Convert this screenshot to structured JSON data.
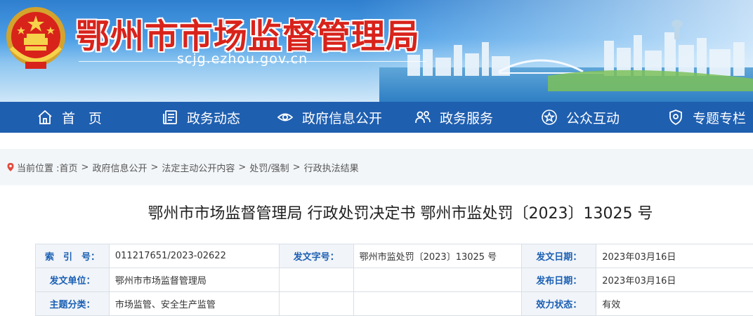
{
  "header": {
    "site_title": "鄂州市市场监督管理局",
    "domain": "scjg.ezhou.gov.cn",
    "emblem_icon": "national-emblem-icon",
    "title_color": "#d8231b"
  },
  "nav": {
    "background": "#1f5fb0",
    "items": [
      {
        "label": "首　页",
        "icon": "home-icon"
      },
      {
        "label": "政务动态",
        "icon": "news-icon"
      },
      {
        "label": "政府信息公开",
        "icon": "eye-icon"
      },
      {
        "label": "政务服务",
        "icon": "people-icon"
      },
      {
        "label": "公众互动",
        "icon": "star-icon"
      },
      {
        "label": "专题专栏",
        "icon": "shield-icon"
      }
    ]
  },
  "breadcrumb": {
    "prefix": "当前位置 :",
    "items": [
      "首页",
      "政府信息公开",
      "法定主动公开内容",
      "处罚/强制",
      "行政执法结果"
    ],
    "separator": ">"
  },
  "document": {
    "title": "鄂州市市场监督管理局 行政处罚决定书 鄂州市监处罚〔2023〕13025 号"
  },
  "info_table": {
    "rows": [
      [
        {
          "label": "索　引　号：",
          "value": "011217651/2023-02622"
        },
        {
          "label": "发文字号：",
          "value": "鄂州市监处罚〔2023〕13025 号"
        },
        {
          "label": "发文日期：",
          "value": "2023年03月16日"
        }
      ],
      [
        {
          "label": "发文单位：",
          "value": "鄂州市市场监督管理局"
        },
        {
          "label": "",
          "value": ""
        },
        {
          "label": "发布日期：",
          "value": "2023年03月16日"
        }
      ],
      [
        {
          "label": "主题分类：",
          "value": "市场监管、安全生产监管"
        },
        {
          "label": "",
          "value": ""
        },
        {
          "label": "效力状态：",
          "value": "有效"
        }
      ]
    ]
  }
}
